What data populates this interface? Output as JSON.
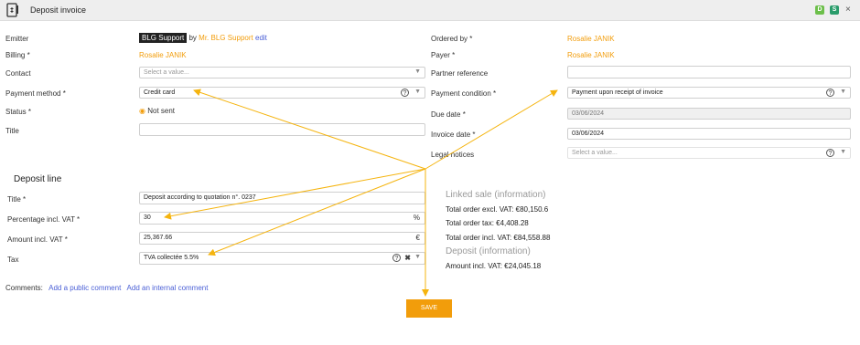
{
  "header": {
    "title": "Deposit invoice",
    "badge_green": "D",
    "badge_green2": "S",
    "close": "×"
  },
  "colors": {
    "accent": "#f29d0b",
    "link": "#4a5fd6",
    "badge": "#6cbf4a",
    "badge2": "#2a9c6b"
  },
  "left": {
    "emitter_label": "Emitter",
    "emitter_tag": "BLG Support",
    "emitter_by": "by",
    "emitter_person": "Mr. BLG Support",
    "emitter_edit": "edit",
    "billing_label": "Billing *",
    "billing_value": "Rosalie JANIK",
    "contact_label": "Contact",
    "contact_placeholder": "Select a value...",
    "payment_method_label": "Payment method *",
    "payment_method_value": "Credit card",
    "status_label": "Status *",
    "status_value": "Not sent",
    "title_label": "Title",
    "title_value": ""
  },
  "right": {
    "ordered_by_label": "Ordered by *",
    "ordered_by_value": "Rosalie JANIK",
    "payer_label": "Payer *",
    "payer_value": "Rosalie JANIK",
    "partner_ref_label": "Partner reference",
    "partner_ref_value": "",
    "payment_condition_label": "Payment condition *",
    "payment_condition_value": "Payment upon receipt of invoice",
    "due_date_label": "Due date *",
    "due_date_value": "03/06/2024",
    "invoice_date_label": "Invoice date *",
    "invoice_date_value": "03/06/2024",
    "legal_notices_label": "Legal notices",
    "legal_notices_placeholder": "Select a value..."
  },
  "deposit": {
    "section_title": "Deposit line",
    "title_label": "Title *",
    "title_value": "Deposit according to quotation n°. 0237",
    "percentage_label": "Percentage incl. VAT *",
    "percentage_value": "30",
    "percentage_unit": "%",
    "amount_label": "Amount incl. VAT *",
    "amount_value": "25,367.66",
    "amount_unit": "€",
    "tax_label": "Tax",
    "tax_value": "TVA collectée 5.5%"
  },
  "info": {
    "linked_sale_header": "Linked sale (information)",
    "total_excl": "Total order excl. VAT: €80,150.6",
    "total_tax": "Total order tax: €4,408.28",
    "total_incl": "Total order incl. VAT: €84,558.88",
    "deposit_header": "Deposit (information)",
    "deposit_amount": "Amount incl. VAT: €24,045.18"
  },
  "comments": {
    "label": "Comments:",
    "public": "Add a public comment",
    "internal": "Add an internal comment"
  },
  "save_label": "SAVE"
}
